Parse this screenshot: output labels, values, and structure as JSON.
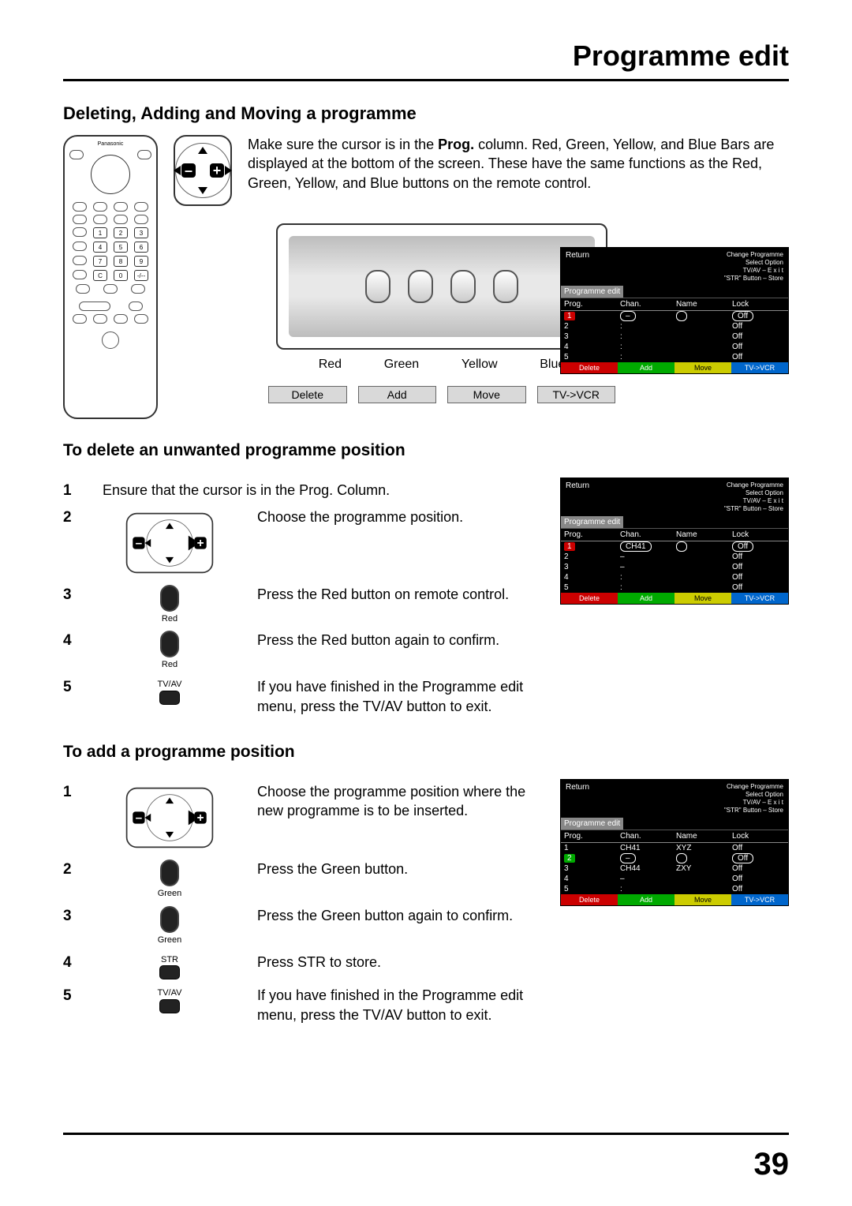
{
  "page_title": "Programme edit",
  "page_number": "39",
  "section1": {
    "heading": "Deleting, Adding and Moving a programme",
    "intro_pre": "Make sure the cursor is in the ",
    "intro_bold": "Prog.",
    "intro_post": " column.\nRed, Green, Yellow, and Blue Bars are displayed at the bottom of the screen. These have the same functions as the Red, Green, Yellow, and Blue buttons on the remote control."
  },
  "tv_colour_labels": [
    "Red",
    "Green",
    "Yellow",
    "Blue"
  ],
  "tv_action_labels": [
    "Delete",
    "Add",
    "Move",
    "TV->VCR"
  ],
  "remote_brand": "Panasonic",
  "remote_keypad": [
    [
      "1",
      "2",
      "3"
    ],
    [
      "4",
      "5",
      "6"
    ],
    [
      "7",
      "8",
      "9"
    ],
    [
      "C",
      "0",
      "-/--"
    ]
  ],
  "osd_common": {
    "title": "Programme edit",
    "return": "Return",
    "hints": [
      "Change Programme",
      "Select Option",
      "TV/AV – E x i t",
      "\"STR\" Button – Store"
    ],
    "cols": [
      "Prog.",
      "Chan.",
      "Name",
      "Lock"
    ],
    "bottom": [
      "Delete",
      "Add",
      "Move",
      "TV->VCR"
    ]
  },
  "osd1_rows": [
    {
      "p": "1",
      "c": "–",
      "n": "",
      "l": "Off",
      "hl": "red"
    },
    {
      "p": "2",
      "c": "",
      "n": "",
      "l": "Off"
    },
    {
      "p": "3",
      "c": "",
      "n": "",
      "l": "Off"
    },
    {
      "p": "4",
      "c": "",
      "n": "",
      "l": "Off"
    },
    {
      "p": "5",
      "c": "",
      "n": "",
      "l": "Off"
    }
  ],
  "osd2_rows": [
    {
      "p": "1",
      "c": "CH41",
      "n": "",
      "l": "Off",
      "hl": "red"
    },
    {
      "p": "2",
      "c": "–",
      "n": "",
      "l": "Off"
    },
    {
      "p": "3",
      "c": "–",
      "n": "",
      "l": "Off"
    },
    {
      "p": "4",
      "c": "",
      "n": "",
      "l": "Off"
    },
    {
      "p": "5",
      "c": "",
      "n": "",
      "l": "Off"
    }
  ],
  "osd3_rows": [
    {
      "p": "1",
      "c": "CH41",
      "n": "XYZ",
      "l": "Off"
    },
    {
      "p": "2",
      "c": "–",
      "n": "",
      "l": "Off",
      "hl": "green"
    },
    {
      "p": "3",
      "c": "CH44",
      "n": "ZXY",
      "l": "Off"
    },
    {
      "p": "4",
      "c": "–",
      "n": "",
      "l": "Off"
    },
    {
      "p": "5",
      "c": "",
      "n": "",
      "l": "Off"
    }
  ],
  "delete": {
    "heading": "To delete an unwanted programme position",
    "s1": "Ensure that the cursor is in the Prog. Column.",
    "s2": "Choose the programme position.",
    "s3": "Press the Red button on remote control.",
    "s3_cap": "Red",
    "s4": "Press the Red button again to confirm.",
    "s4_cap": "Red",
    "s5": "If you have finished in the Programme edit menu, press the TV/AV button to exit.",
    "s5_cap": "TV/AV"
  },
  "add": {
    "heading": "To add a programme position",
    "s1": "Choose the programme position where the new programme is to be inserted.",
    "s2": "Press the Green button.",
    "s2_cap": "Green",
    "s3": "Press the Green button again to confirm.",
    "s3_cap": "Green",
    "s4": "Press STR to store.",
    "s4_cap": "STR",
    "s5": "If you have finished in the Programme edit menu, press the TV/AV button to exit.",
    "s5_cap": "TV/AV"
  },
  "step_nums": {
    "n1": "1",
    "n2": "2",
    "n3": "3",
    "n4": "4",
    "n5": "5"
  }
}
